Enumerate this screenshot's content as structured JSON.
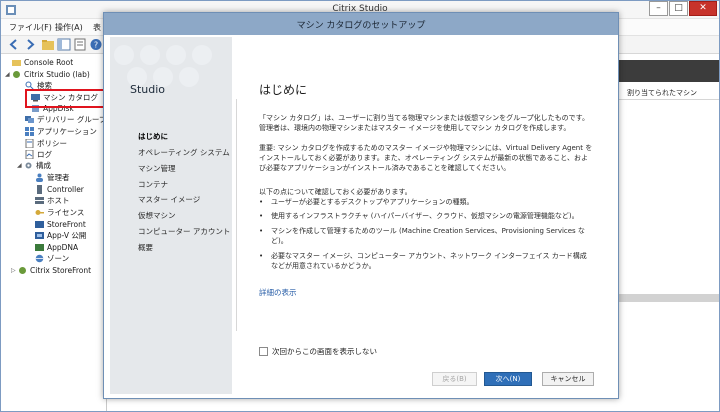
{
  "main_window": {
    "title": "Citrix Studio",
    "controls": [
      "–",
      "□",
      "✕"
    ]
  },
  "menubar": {
    "items": [
      "ファイル(F)",
      "操作(A)",
      "表"
    ]
  },
  "tree": {
    "items": [
      {
        "label": "Console Root",
        "level": 0,
        "arrow": ""
      },
      {
        "label": "Citrix Studio (lab)",
        "level": 1,
        "arrow": "◢"
      },
      {
        "label": "検索",
        "level": 2,
        "arrow": ""
      },
      {
        "label": "マシン カタログ",
        "level": 2,
        "arrow": ""
      },
      {
        "label": "AppDisk",
        "level": 2,
        "arrow": ""
      },
      {
        "label": "デリバリー グループ",
        "level": 2,
        "arrow": ""
      },
      {
        "label": "アプリケーション",
        "level": 2,
        "arrow": ""
      },
      {
        "label": "ポリシー",
        "level": 2,
        "arrow": ""
      },
      {
        "label": "ログ",
        "level": 2,
        "arrow": ""
      },
      {
        "label": "構成",
        "level": 2,
        "arrow": "◢"
      },
      {
        "label": "管理者",
        "level": 3,
        "arrow": ""
      },
      {
        "label": "Controller",
        "level": 3,
        "arrow": ""
      },
      {
        "label": "ホスト",
        "level": 3,
        "arrow": ""
      },
      {
        "label": "ライセンス",
        "level": 3,
        "arrow": ""
      },
      {
        "label": "StoreFront",
        "level": 3,
        "arrow": ""
      },
      {
        "label": "App-V 公開",
        "level": 3,
        "arrow": ""
      },
      {
        "label": "AppDNA",
        "level": 3,
        "arrow": ""
      },
      {
        "label": "ゾーン",
        "level": 3,
        "arrow": ""
      },
      {
        "label": "Citrix StoreFront",
        "level": 1,
        "arrow": "▷"
      }
    ]
  },
  "right_pane": {
    "column_header": "割り当てられたマシン"
  },
  "dialog": {
    "title": "マシン カタログのセットアップ",
    "brand": "Studio",
    "steps": [
      "はじめに",
      "オペレーティング システム",
      "マシン管理",
      "コンテナ",
      "マスター イメージ",
      "仮想マシン",
      "コンピューター アカウント",
      "概要"
    ],
    "active_step": 0,
    "heading": "はじめに",
    "para1": "「マシン カタログ」は、ユーザーに割り当てる物理マシンまたは仮想マシンをグループ化したものです。管理者は、環境内の物理マシンまたはマスター イメージを使用してマシン カタログを作成します。",
    "para2": "重要: マシン カタログを作成するためのマスター イメージや物理マシンには、Virtual Delivery Agent をインストールしておく必要があります。また、オペレーティング システムが最新の状態であること、および必要なアプリケーションがインストール済みであることを確認してください。",
    "para3": "以下の点について確認しておく必要があります。",
    "bullets": [
      "ユーザーが必要とするデスクトップやアプリケーションの種類。",
      "使用するインフラストラクチャ (ハイパーバイザー、クラウド、仮想マシンの電源管理機能など)。",
      "マシンを作成して管理するためのツール (Machine Creation Services、Provisioning Services など)。",
      "必要なマスター イメージ、コンピューター アカウント、ネットワーク インターフェイス カード構成などが用意されているかどうか。"
    ],
    "details_link": "詳細の表示",
    "dont_show_label": "次回からこの画面を表示しない",
    "buttons": {
      "back": "戻る(B)",
      "next": "次へ(N)",
      "cancel": "キャンセル"
    }
  },
  "colors": {
    "dialog_titlebar": "#8da8c7",
    "primary_button": "#2f6fb8",
    "highlight_box": "#e0141e",
    "link": "#2a5fa8"
  }
}
